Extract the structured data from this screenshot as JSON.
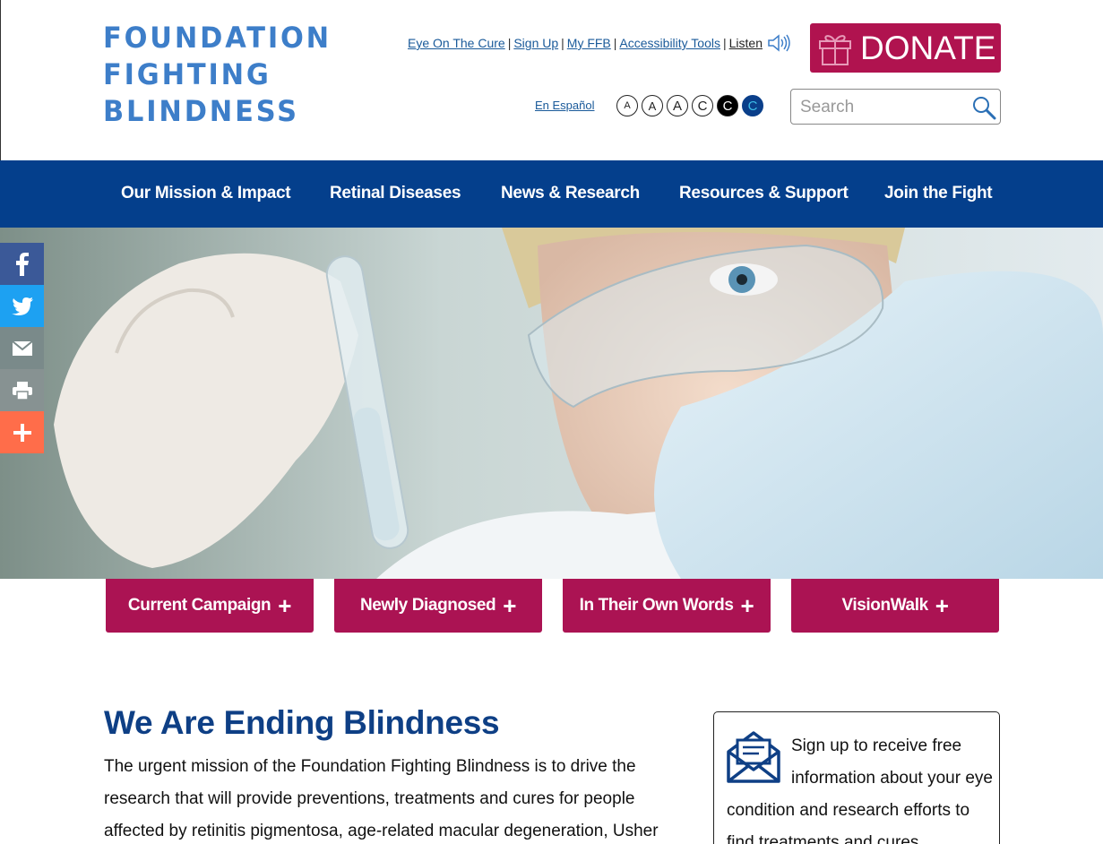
{
  "header": {
    "logo_lines": [
      "FOUNDATION",
      "FIGHTING",
      "BLINDNESS"
    ],
    "utility_links": [
      "Eye On The Cure",
      "Sign Up",
      "My FFB",
      "Accessibility Tools"
    ],
    "listen_label": "Listen",
    "donate_label": "DONATE",
    "espanol_label": "En Español",
    "size_toggles": [
      "A",
      "A",
      "A",
      "C",
      "C",
      "C"
    ],
    "search_placeholder": "Search"
  },
  "nav": {
    "items": [
      "Our Mission & Impact",
      "Retinal Diseases",
      "News & Research",
      "Resources & Support",
      "Join the Fight"
    ]
  },
  "tabs": [
    "Current Campaign",
    "Newly Diagnosed",
    "In Their Own Words",
    "VisionWalk"
  ],
  "tab_plus": "+",
  "main": {
    "title": "We Are Ending Blindness",
    "body": "The urgent mission of the Foundation Fighting Blindness is to drive the research that will provide preventions, treatments and cures for people affected by retinitis pigmentosa, age-related macular degeneration, Usher"
  },
  "signup": {
    "text": "Sign up to receive free information about your eye condition and research efforts to find treatments and cures."
  },
  "colors": {
    "brand_blue": "#043f8c",
    "logo_blue": "#3d7ec9",
    "accent_magenta": "#ab1353"
  }
}
